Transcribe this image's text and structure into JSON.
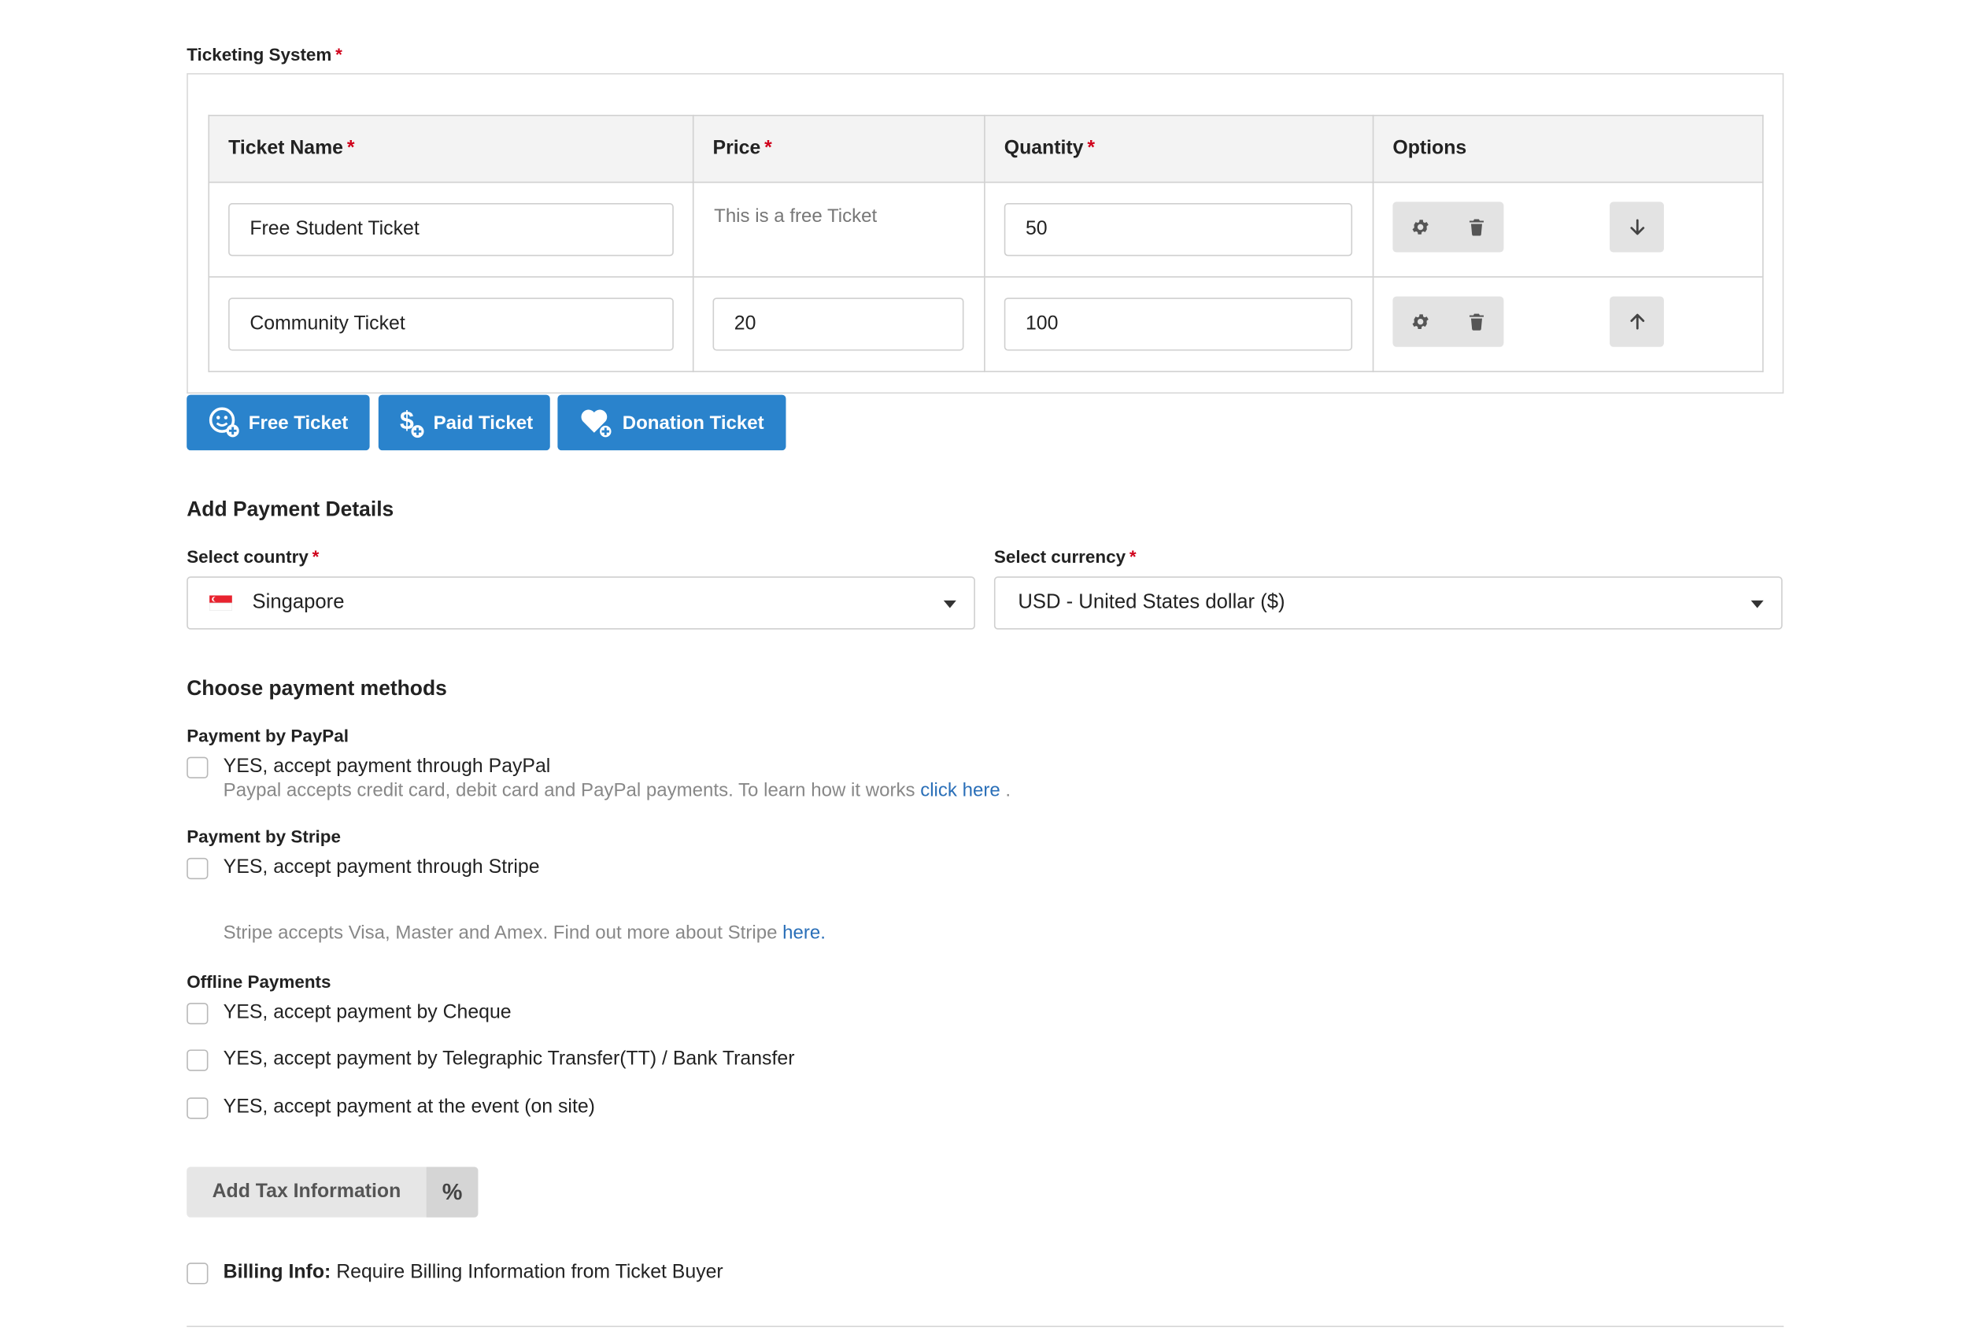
{
  "ticketing": {
    "label": "Ticketing System",
    "required_mark": "*",
    "columns": {
      "name": "Ticket Name",
      "price": "Price",
      "quantity": "Quantity",
      "options": "Options"
    },
    "rows": [
      {
        "name": "Free Student Ticket",
        "price_note": "This is a free Ticket",
        "quantity": "50"
      },
      {
        "name": "Community Ticket",
        "price": "20",
        "quantity": "100"
      }
    ],
    "buttons": {
      "free": "Free Ticket",
      "paid": "Paid Ticket",
      "donation": "Donation Ticket"
    }
  },
  "payment_details": {
    "title": "Add Payment Details",
    "country_label": "Select country",
    "country_value": "Singapore",
    "currency_label": "Select currency",
    "currency_value": "USD - United States dollar ($)"
  },
  "payment_methods": {
    "title": "Choose payment methods",
    "paypal": {
      "heading": "Payment by PayPal",
      "option": "YES, accept payment through PayPal",
      "note": "Paypal accepts credit card, debit card and PayPal payments. To learn how it works",
      "link": "click here",
      "note_end": "."
    },
    "stripe": {
      "heading": "Payment by Stripe",
      "option": "YES, accept payment through Stripe",
      "note": "Stripe accepts Visa, Master and Amex. Find out more about Stripe",
      "link": "here."
    },
    "offline": {
      "heading": "Offline Payments",
      "options": [
        "YES, accept payment by Cheque",
        "YES, accept payment by Telegraphic Transfer(TT) / Bank Transfer",
        "YES, accept payment at the event (on site)"
      ]
    }
  },
  "tax": {
    "button": "Add Tax Information",
    "icon_text": "%"
  },
  "billing": {
    "bold": "Billing Info:",
    "text": "Require Billing Information from Ticket Buyer"
  },
  "colors": {
    "primary": "#2a83cc",
    "required": "#d0021b",
    "link": "#2a6fb8"
  },
  "icons": [
    "gear-icon",
    "trash-icon",
    "arrow-down-icon",
    "arrow-up-icon",
    "smiley-plus-icon",
    "dollar-plus-icon",
    "heart-plus-icon",
    "singapore-flag-icon",
    "caret-down-icon",
    "percent-icon"
  ]
}
